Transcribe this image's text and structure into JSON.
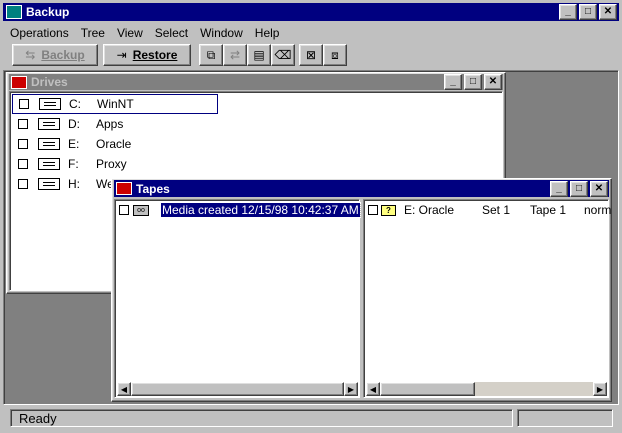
{
  "app": {
    "title": "Backup"
  },
  "menu": [
    "Operations",
    "Tree",
    "View",
    "Select",
    "Window",
    "Help"
  ],
  "toolbar": {
    "backup_label": "Backup",
    "restore_label": "Restore"
  },
  "drives": {
    "title": "Drives",
    "items": [
      {
        "letter": "C:",
        "name": "WinNT"
      },
      {
        "letter": "D:",
        "name": "Apps"
      },
      {
        "letter": "E:",
        "name": "Oracle"
      },
      {
        "letter": "F:",
        "name": "Proxy"
      },
      {
        "letter": "H:",
        "name": "Wel"
      }
    ]
  },
  "tapes": {
    "title": "Tapes",
    "media_label": "Media created 12/15/98 10:42:37 AM",
    "right_row": {
      "drive": "E: Oracle",
      "set": "Set 1",
      "tape": "Tape 1",
      "type": "norm"
    }
  },
  "status": {
    "text": "Ready"
  }
}
